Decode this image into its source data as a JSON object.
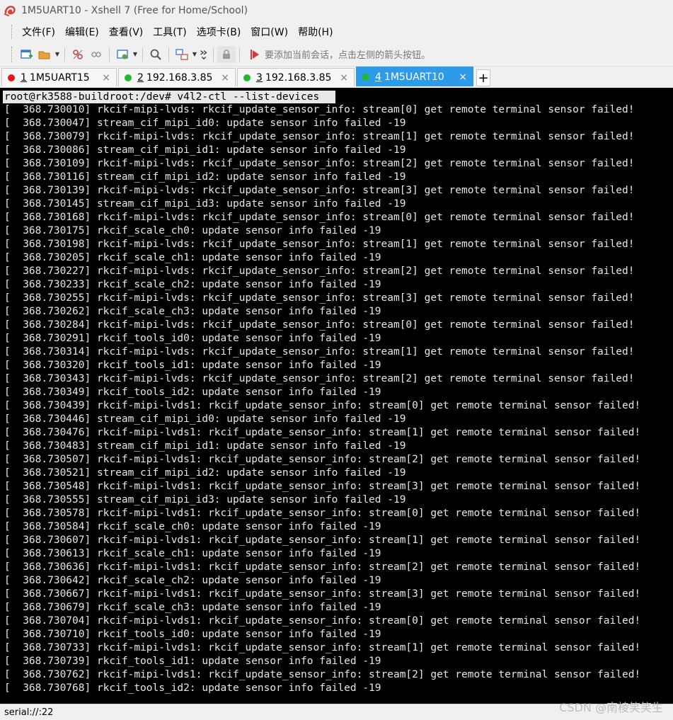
{
  "window": {
    "title": "1M5UART10 - Xshell 7 (Free for Home/School)"
  },
  "menu": {
    "items": [
      "文件(F)",
      "编辑(E)",
      "查看(V)",
      "工具(T)",
      "选项卡(B)",
      "窗口(W)",
      "帮助(H)"
    ]
  },
  "toolbar": {
    "hint": "要添加当前会话，点击左侧的箭头按钮。"
  },
  "tabs": [
    {
      "number": "1",
      "label": "1M5UART15",
      "dot_color": "#e8141c",
      "active": false
    },
    {
      "number": "2",
      "label": "192.168.3.85",
      "dot_color": "#1fb82e",
      "active": false
    },
    {
      "number": "3",
      "label": "192.168.3.85",
      "dot_color": "#1fb82e",
      "active": false
    },
    {
      "number": "4",
      "label": "1M5UART10",
      "dot_color": "#1fb82e",
      "active": true
    }
  ],
  "tab_close_glyph": "×",
  "tab_add_glyph": "+",
  "terminal": {
    "prompt": "root@rk3588-buildroot:/dev# v4l2-ctl --list-devices",
    "lines": [
      "[  368.730010] rkcif-mipi-lvds: rkcif_update_sensor_info: stream[0] get remote terminal sensor failed!",
      "[  368.730047] stream_cif_mipi_id0: update sensor info failed -19",
      "[  368.730079] rkcif-mipi-lvds: rkcif_update_sensor_info: stream[1] get remote terminal sensor failed!",
      "[  368.730086] stream_cif_mipi_id1: update sensor info failed -19",
      "[  368.730109] rkcif-mipi-lvds: rkcif_update_sensor_info: stream[2] get remote terminal sensor failed!",
      "[  368.730116] stream_cif_mipi_id2: update sensor info failed -19",
      "[  368.730139] rkcif-mipi-lvds: rkcif_update_sensor_info: stream[3] get remote terminal sensor failed!",
      "[  368.730145] stream_cif_mipi_id3: update sensor info failed -19",
      "[  368.730168] rkcif-mipi-lvds: rkcif_update_sensor_info: stream[0] get remote terminal sensor failed!",
      "[  368.730175] rkcif_scale_ch0: update sensor info failed -19",
      "[  368.730198] rkcif-mipi-lvds: rkcif_update_sensor_info: stream[1] get remote terminal sensor failed!",
      "[  368.730205] rkcif_scale_ch1: update sensor info failed -19",
      "[  368.730227] rkcif-mipi-lvds: rkcif_update_sensor_info: stream[2] get remote terminal sensor failed!",
      "[  368.730233] rkcif_scale_ch2: update sensor info failed -19",
      "[  368.730255] rkcif-mipi-lvds: rkcif_update_sensor_info: stream[3] get remote terminal sensor failed!",
      "[  368.730262] rkcif_scale_ch3: update sensor info failed -19",
      "[  368.730284] rkcif-mipi-lvds: rkcif_update_sensor_info: stream[0] get remote terminal sensor failed!",
      "[  368.730291] rkcif_tools_id0: update sensor info failed -19",
      "[  368.730314] rkcif-mipi-lvds: rkcif_update_sensor_info: stream[1] get remote terminal sensor failed!",
      "[  368.730320] rkcif_tools_id1: update sensor info failed -19",
      "[  368.730343] rkcif-mipi-lvds: rkcif_update_sensor_info: stream[2] get remote terminal sensor failed!",
      "[  368.730349] rkcif_tools_id2: update sensor info failed -19",
      "[  368.730439] rkcif-mipi-lvds1: rkcif_update_sensor_info: stream[0] get remote terminal sensor failed!",
      "[  368.730446] stream_cif_mipi_id0: update sensor info failed -19",
      "[  368.730476] rkcif-mipi-lvds1: rkcif_update_sensor_info: stream[1] get remote terminal sensor failed!",
      "[  368.730483] stream_cif_mipi_id1: update sensor info failed -19",
      "[  368.730507] rkcif-mipi-lvds1: rkcif_update_sensor_info: stream[2] get remote terminal sensor failed!",
      "[  368.730521] stream_cif_mipi_id2: update sensor info failed -19",
      "[  368.730548] rkcif-mipi-lvds1: rkcif_update_sensor_info: stream[3] get remote terminal sensor failed!",
      "[  368.730555] stream_cif_mipi_id3: update sensor info failed -19",
      "[  368.730578] rkcif-mipi-lvds1: rkcif_update_sensor_info: stream[0] get remote terminal sensor failed!",
      "[  368.730584] rkcif_scale_ch0: update sensor info failed -19",
      "[  368.730607] rkcif-mipi-lvds1: rkcif_update_sensor_info: stream[1] get remote terminal sensor failed!",
      "[  368.730613] rkcif_scale_ch1: update sensor info failed -19",
      "[  368.730636] rkcif-mipi-lvds1: rkcif_update_sensor_info: stream[2] get remote terminal sensor failed!",
      "[  368.730642] rkcif_scale_ch2: update sensor info failed -19",
      "[  368.730667] rkcif-mipi-lvds1: rkcif_update_sensor_info: stream[3] get remote terminal sensor failed!",
      "[  368.730679] rkcif_scale_ch3: update sensor info failed -19",
      "[  368.730704] rkcif-mipi-lvds1: rkcif_update_sensor_info: stream[0] get remote terminal sensor failed!",
      "[  368.730710] rkcif_tools_id0: update sensor info failed -19",
      "[  368.730733] rkcif-mipi-lvds1: rkcif_update_sensor_info: stream[1] get remote terminal sensor failed!",
      "[  368.730739] rkcif_tools_id1: update sensor info failed -19",
      "[  368.730762] rkcif-mipi-lvds1: rkcif_update_sensor_info: stream[2] get remote terminal sensor failed!",
      "[  368.730768] rkcif_tools_id2: update sensor info failed -19"
    ]
  },
  "statusbar": {
    "connection": "serial://:22"
  },
  "watermark": "CSDN @南棱笑笑生",
  "colors": {
    "active_tab": "#2e9be8",
    "terminal_bg": "#000000",
    "terminal_fg": "#e6e6e6"
  },
  "icons": {
    "app_logo": "xshell-logo-icon",
    "toolbar": [
      "new-session-icon",
      "open-folder-icon",
      "disconnect-icon",
      "reconnect-icon",
      "session-properties-icon",
      "find-icon",
      "transfer-icon",
      "more-icon",
      "lock-icon",
      "arrow-hint-icon"
    ]
  }
}
